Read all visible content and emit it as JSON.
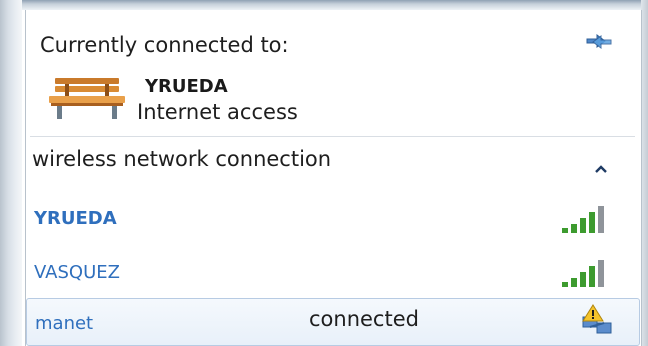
{
  "popup": {
    "header_title": "Currently connected to:",
    "connection": {
      "name": "YRUEDA",
      "status": "Internet access",
      "icon": "bench-network-icon"
    },
    "section": {
      "title": "wireless network connection",
      "expanded": true
    },
    "networks": [
      {
        "name": "YRUEDA",
        "bold": true,
        "status": "",
        "icon": "signal-strength-icon"
      },
      {
        "name": "VASQUEZ",
        "bold": false,
        "status": "",
        "icon": "signal-strength-icon"
      },
      {
        "name": "manet",
        "bold": false,
        "status": "connected",
        "icon": "warning-network-icon",
        "selected": true
      }
    ]
  },
  "colors": {
    "network_link": "#2f6fbd",
    "signal_green": "#3d9b2f",
    "selected_row_border": "#b7cbe3"
  }
}
